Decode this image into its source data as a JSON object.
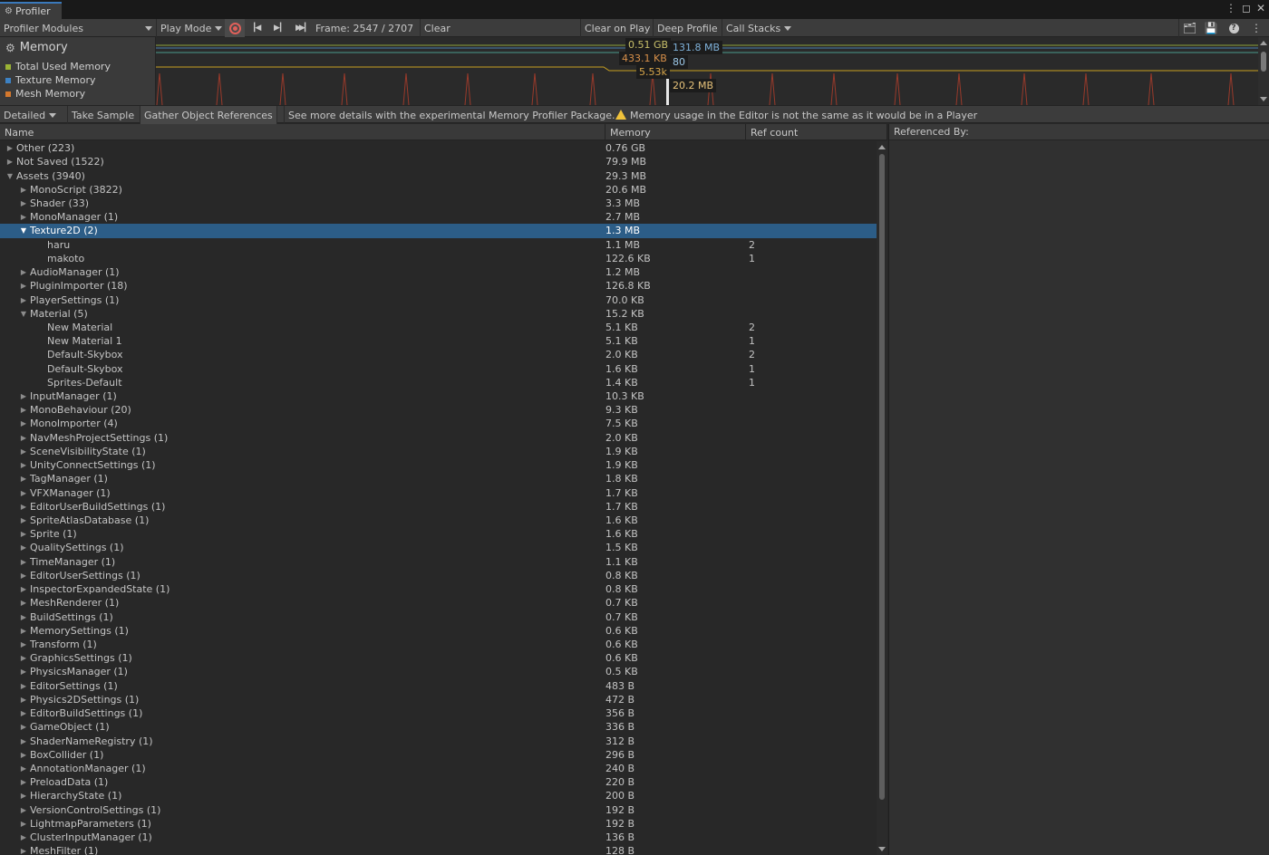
{
  "window": {
    "title": "Profiler"
  },
  "toolbar": {
    "modules_label": "Profiler Modules",
    "play_mode_label": "Play Mode",
    "frame_label": "Frame: 2547 / 2707",
    "clear_label": "Clear",
    "clear_on_play_label": "Clear on Play",
    "deep_profile_label": "Deep Profile",
    "call_stacks_label": "Call Stacks"
  },
  "module": {
    "title": "Memory",
    "legend": [
      {
        "label": "Total Used Memory",
        "color": "#9bb335"
      },
      {
        "label": "Texture Memory",
        "color": "#3d82c4"
      },
      {
        "label": "Mesh Memory",
        "color": "#d4782d"
      }
    ]
  },
  "chart_tooltips": [
    {
      "text": "0.51 GB",
      "color": "#c9c06a"
    },
    {
      "text": "131.8 MB",
      "color": "#7fb1d9"
    },
    {
      "text": "433.1 KB",
      "color": "#d8904a"
    },
    {
      "text": "80",
      "color": "#9cc8e8"
    },
    {
      "text": "5.53k",
      "color": "#d8a64a"
    },
    {
      "text": "20.2 MB",
      "color": "#e6c27a"
    }
  ],
  "toolbar2": {
    "view_label": "Detailed",
    "take_sample_label": "Take Sample",
    "gather_refs_label": "Gather Object References",
    "package_hint": "See more details with the experimental Memory Profiler Package.",
    "warning_text": "Memory usage in the Editor is not the same as it would be in a Player"
  },
  "table": {
    "col_name": "Name",
    "col_memory": "Memory",
    "col_ref": "Ref count",
    "rows": [
      {
        "level": 0,
        "state": "collapsed",
        "name": "Other (223)",
        "memory": "0.76 GB",
        "ref": ""
      },
      {
        "level": 0,
        "state": "collapsed",
        "name": "Not Saved (1522)",
        "memory": "79.9 MB",
        "ref": ""
      },
      {
        "level": 0,
        "state": "expanded",
        "name": "Assets (3940)",
        "memory": "29.3 MB",
        "ref": ""
      },
      {
        "level": 1,
        "state": "collapsed",
        "name": "MonoScript (3822)",
        "memory": "20.6 MB",
        "ref": ""
      },
      {
        "level": 1,
        "state": "collapsed",
        "name": "Shader (33)",
        "memory": "3.3 MB",
        "ref": ""
      },
      {
        "level": 1,
        "state": "collapsed",
        "name": "MonoManager (1)",
        "memory": "2.7 MB",
        "ref": ""
      },
      {
        "level": 1,
        "state": "expanded",
        "name": "Texture2D (2)",
        "memory": "1.3 MB",
        "ref": "",
        "selected": true
      },
      {
        "level": 2,
        "state": "leaf",
        "name": "haru",
        "memory": "1.1 MB",
        "ref": "2"
      },
      {
        "level": 2,
        "state": "leaf",
        "name": "makoto",
        "memory": "122.6 KB",
        "ref": "1"
      },
      {
        "level": 1,
        "state": "collapsed",
        "name": "AudioManager (1)",
        "memory": "1.2 MB",
        "ref": ""
      },
      {
        "level": 1,
        "state": "collapsed",
        "name": "PluginImporter (18)",
        "memory": "126.8 KB",
        "ref": ""
      },
      {
        "level": 1,
        "state": "collapsed",
        "name": "PlayerSettings (1)",
        "memory": "70.0 KB",
        "ref": ""
      },
      {
        "level": 1,
        "state": "expanded",
        "name": "Material (5)",
        "memory": "15.2 KB",
        "ref": ""
      },
      {
        "level": 2,
        "state": "leaf",
        "name": "New Material",
        "memory": "5.1 KB",
        "ref": "2"
      },
      {
        "level": 2,
        "state": "leaf",
        "name": "New Material 1",
        "memory": "5.1 KB",
        "ref": "1"
      },
      {
        "level": 2,
        "state": "leaf",
        "name": "Default-Skybox",
        "memory": "2.0 KB",
        "ref": "2"
      },
      {
        "level": 2,
        "state": "leaf",
        "name": "Default-Skybox",
        "memory": "1.6 KB",
        "ref": "1"
      },
      {
        "level": 2,
        "state": "leaf",
        "name": "Sprites-Default",
        "memory": "1.4 KB",
        "ref": "1"
      },
      {
        "level": 1,
        "state": "collapsed",
        "name": "InputManager (1)",
        "memory": "10.3 KB",
        "ref": ""
      },
      {
        "level": 1,
        "state": "collapsed",
        "name": "MonoBehaviour (20)",
        "memory": "9.3 KB",
        "ref": ""
      },
      {
        "level": 1,
        "state": "collapsed",
        "name": "MonoImporter (4)",
        "memory": "7.5 KB",
        "ref": ""
      },
      {
        "level": 1,
        "state": "collapsed",
        "name": "NavMeshProjectSettings (1)",
        "memory": "2.0 KB",
        "ref": ""
      },
      {
        "level": 1,
        "state": "collapsed",
        "name": "SceneVisibilityState (1)",
        "memory": "1.9 KB",
        "ref": ""
      },
      {
        "level": 1,
        "state": "collapsed",
        "name": "UnityConnectSettings (1)",
        "memory": "1.9 KB",
        "ref": ""
      },
      {
        "level": 1,
        "state": "collapsed",
        "name": "TagManager (1)",
        "memory": "1.8 KB",
        "ref": ""
      },
      {
        "level": 1,
        "state": "collapsed",
        "name": "VFXManager (1)",
        "memory": "1.7 KB",
        "ref": ""
      },
      {
        "level": 1,
        "state": "collapsed",
        "name": "EditorUserBuildSettings (1)",
        "memory": "1.7 KB",
        "ref": ""
      },
      {
        "level": 1,
        "state": "collapsed",
        "name": "SpriteAtlasDatabase (1)",
        "memory": "1.6 KB",
        "ref": ""
      },
      {
        "level": 1,
        "state": "collapsed",
        "name": "Sprite (1)",
        "memory": "1.6 KB",
        "ref": ""
      },
      {
        "level": 1,
        "state": "collapsed",
        "name": "QualitySettings (1)",
        "memory": "1.5 KB",
        "ref": ""
      },
      {
        "level": 1,
        "state": "collapsed",
        "name": "TimeManager (1)",
        "memory": "1.1 KB",
        "ref": ""
      },
      {
        "level": 1,
        "state": "collapsed",
        "name": "EditorUserSettings (1)",
        "memory": "0.8 KB",
        "ref": ""
      },
      {
        "level": 1,
        "state": "collapsed",
        "name": "InspectorExpandedState (1)",
        "memory": "0.8 KB",
        "ref": ""
      },
      {
        "level": 1,
        "state": "collapsed",
        "name": "MeshRenderer (1)",
        "memory": "0.7 KB",
        "ref": ""
      },
      {
        "level": 1,
        "state": "collapsed",
        "name": "BuildSettings (1)",
        "memory": "0.7 KB",
        "ref": ""
      },
      {
        "level": 1,
        "state": "collapsed",
        "name": "MemorySettings (1)",
        "memory": "0.6 KB",
        "ref": ""
      },
      {
        "level": 1,
        "state": "collapsed",
        "name": "Transform (1)",
        "memory": "0.6 KB",
        "ref": ""
      },
      {
        "level": 1,
        "state": "collapsed",
        "name": "GraphicsSettings (1)",
        "memory": "0.6 KB",
        "ref": ""
      },
      {
        "level": 1,
        "state": "collapsed",
        "name": "PhysicsManager (1)",
        "memory": "0.5 KB",
        "ref": ""
      },
      {
        "level": 1,
        "state": "collapsed",
        "name": "EditorSettings (1)",
        "memory": "483 B",
        "ref": ""
      },
      {
        "level": 1,
        "state": "collapsed",
        "name": "Physics2DSettings (1)",
        "memory": "472 B",
        "ref": ""
      },
      {
        "level": 1,
        "state": "collapsed",
        "name": "EditorBuildSettings (1)",
        "memory": "356 B",
        "ref": ""
      },
      {
        "level": 1,
        "state": "collapsed",
        "name": "GameObject (1)",
        "memory": "336 B",
        "ref": ""
      },
      {
        "level": 1,
        "state": "collapsed",
        "name": "ShaderNameRegistry (1)",
        "memory": "312 B",
        "ref": ""
      },
      {
        "level": 1,
        "state": "collapsed",
        "name": "BoxCollider (1)",
        "memory": "296 B",
        "ref": ""
      },
      {
        "level": 1,
        "state": "collapsed",
        "name": "AnnotationManager (1)",
        "memory": "240 B",
        "ref": ""
      },
      {
        "level": 1,
        "state": "collapsed",
        "name": "PreloadData (1)",
        "memory": "220 B",
        "ref": ""
      },
      {
        "level": 1,
        "state": "collapsed",
        "name": "HierarchyState (1)",
        "memory": "200 B",
        "ref": ""
      },
      {
        "level": 1,
        "state": "collapsed",
        "name": "VersionControlSettings (1)",
        "memory": "192 B",
        "ref": ""
      },
      {
        "level": 1,
        "state": "collapsed",
        "name": "LightmapParameters (1)",
        "memory": "192 B",
        "ref": ""
      },
      {
        "level": 1,
        "state": "collapsed",
        "name": "ClusterInputManager (1)",
        "memory": "136 B",
        "ref": ""
      },
      {
        "level": 1,
        "state": "collapsed",
        "name": "MeshFilter (1)",
        "memory": "128 B",
        "ref": ""
      }
    ]
  },
  "ref_panel": {
    "title": "Referenced By:"
  }
}
